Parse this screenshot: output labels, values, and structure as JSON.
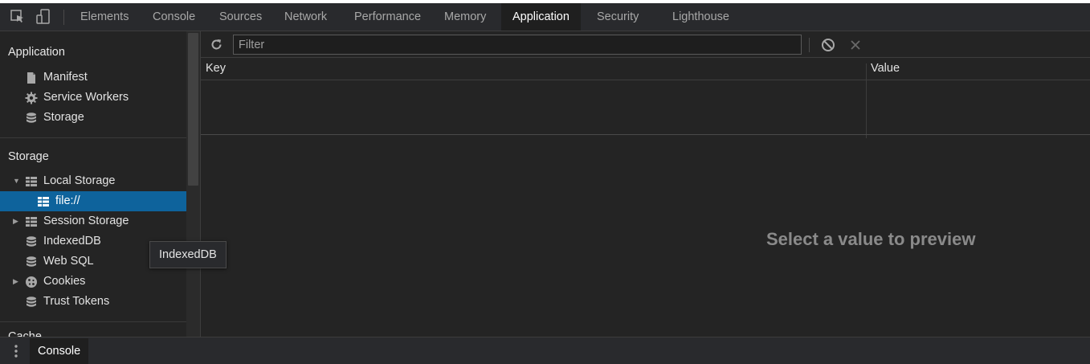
{
  "tabs": [
    {
      "label": "Elements"
    },
    {
      "label": "Console"
    },
    {
      "label": "Sources"
    },
    {
      "label": "Network"
    },
    {
      "label": "Performance"
    },
    {
      "label": "Memory"
    },
    {
      "label": "Application",
      "active": true
    },
    {
      "label": "Security"
    },
    {
      "label": "Lighthouse"
    }
  ],
  "sidebar": {
    "application_title": "Application",
    "application_items": [
      {
        "label": "Manifest",
        "icon": "file-icon"
      },
      {
        "label": "Service Workers",
        "icon": "gear-icon"
      },
      {
        "label": "Storage",
        "icon": "database-icon"
      }
    ],
    "storage_title": "Storage",
    "storage_items": [
      {
        "label": "Local Storage",
        "icon": "table-icon",
        "expanded": true
      },
      {
        "label": "file://",
        "icon": "table-icon",
        "selected": true
      },
      {
        "label": "Session Storage",
        "icon": "table-icon",
        "expanded": false
      },
      {
        "label": "IndexedDB",
        "icon": "database-icon"
      },
      {
        "label": "Web SQL",
        "icon": "database-icon"
      },
      {
        "label": "Cookies",
        "icon": "cookie-icon",
        "expanded": false
      },
      {
        "label": "Trust Tokens",
        "icon": "database-icon"
      }
    ],
    "cache_title_partial": "Cache"
  },
  "toolbar": {
    "filter_placeholder": "Filter",
    "filter_value": ""
  },
  "table": {
    "columns": [
      "Key",
      "Value"
    ],
    "rows": []
  },
  "preview": {
    "message": "Select a value to preview"
  },
  "tooltip": {
    "text": "IndexedDB"
  },
  "drawer": {
    "tab_label": "Console"
  },
  "colors": {
    "background": "#242424",
    "selected": "#0e639c",
    "text": "#e3e3e3",
    "muted": "#8a8a8a"
  }
}
